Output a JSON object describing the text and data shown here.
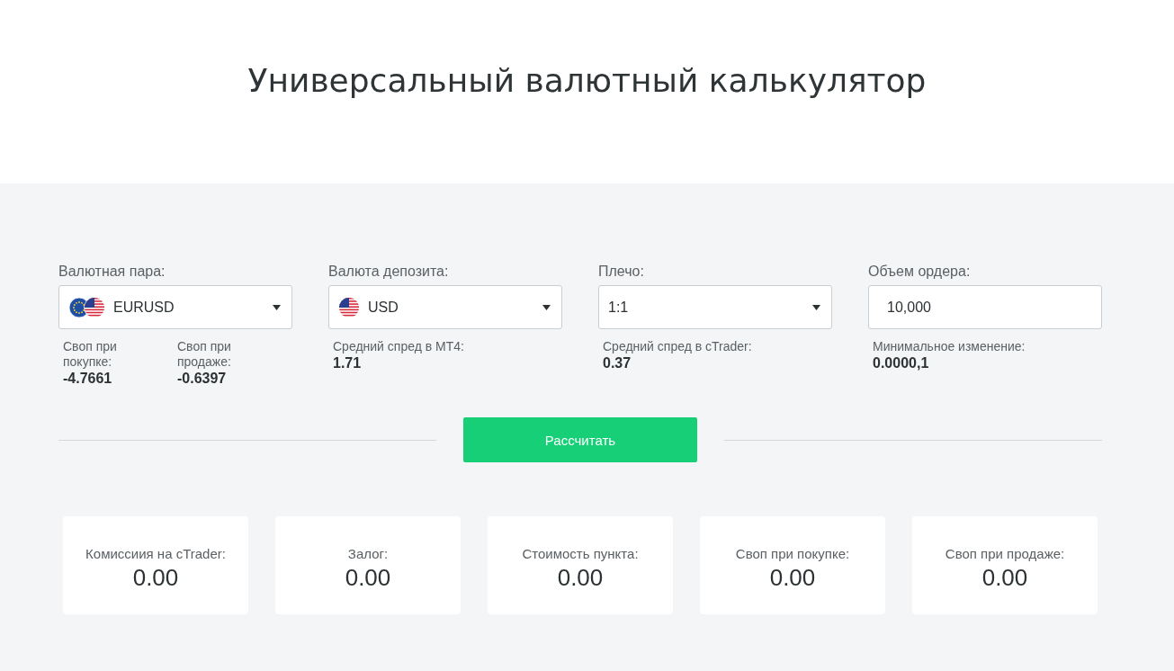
{
  "title": "Универсальный валютный калькулятор",
  "fields": [
    {
      "kind": "select",
      "label": "Валютная пара:",
      "value": "EURUSD",
      "flags": [
        {
          "kind": "eu"
        },
        {
          "kind": "us"
        }
      ],
      "info": [
        {
          "label": "Своп при покупке:",
          "value": "-4.7661"
        },
        {
          "label": "Своп при продаже:",
          "value": "-0.6397"
        }
      ]
    },
    {
      "kind": "select",
      "label": "Валюта депозита:",
      "value": "USD",
      "flags": [
        {
          "kind": "us"
        }
      ],
      "info": [
        {
          "label": "Средний спред в MT4:",
          "value": "1.71"
        }
      ]
    },
    {
      "kind": "select",
      "label": "Плечо:",
      "value": "1:1",
      "info": [
        {
          "label": "Средний спред в cTrader:",
          "value": "0.37"
        }
      ]
    },
    {
      "kind": "input",
      "label": "Объем ордера:",
      "value": "10,000",
      "info": [
        {
          "label": "Минимальное изменение:",
          "value": "0.0000,1"
        }
      ]
    }
  ],
  "calculate_button": "Рассчитать",
  "results": [
    {
      "label": "Комиссиия на cTrader:",
      "value": "0.00"
    },
    {
      "label": "Залог:",
      "value": "0.00"
    },
    {
      "label": "Стоимость пункта:",
      "value": "0.00"
    },
    {
      "label": "Своп при покупке:",
      "value": "0.00"
    },
    {
      "label": "Своп при продаже:",
      "value": "0.00"
    }
  ]
}
